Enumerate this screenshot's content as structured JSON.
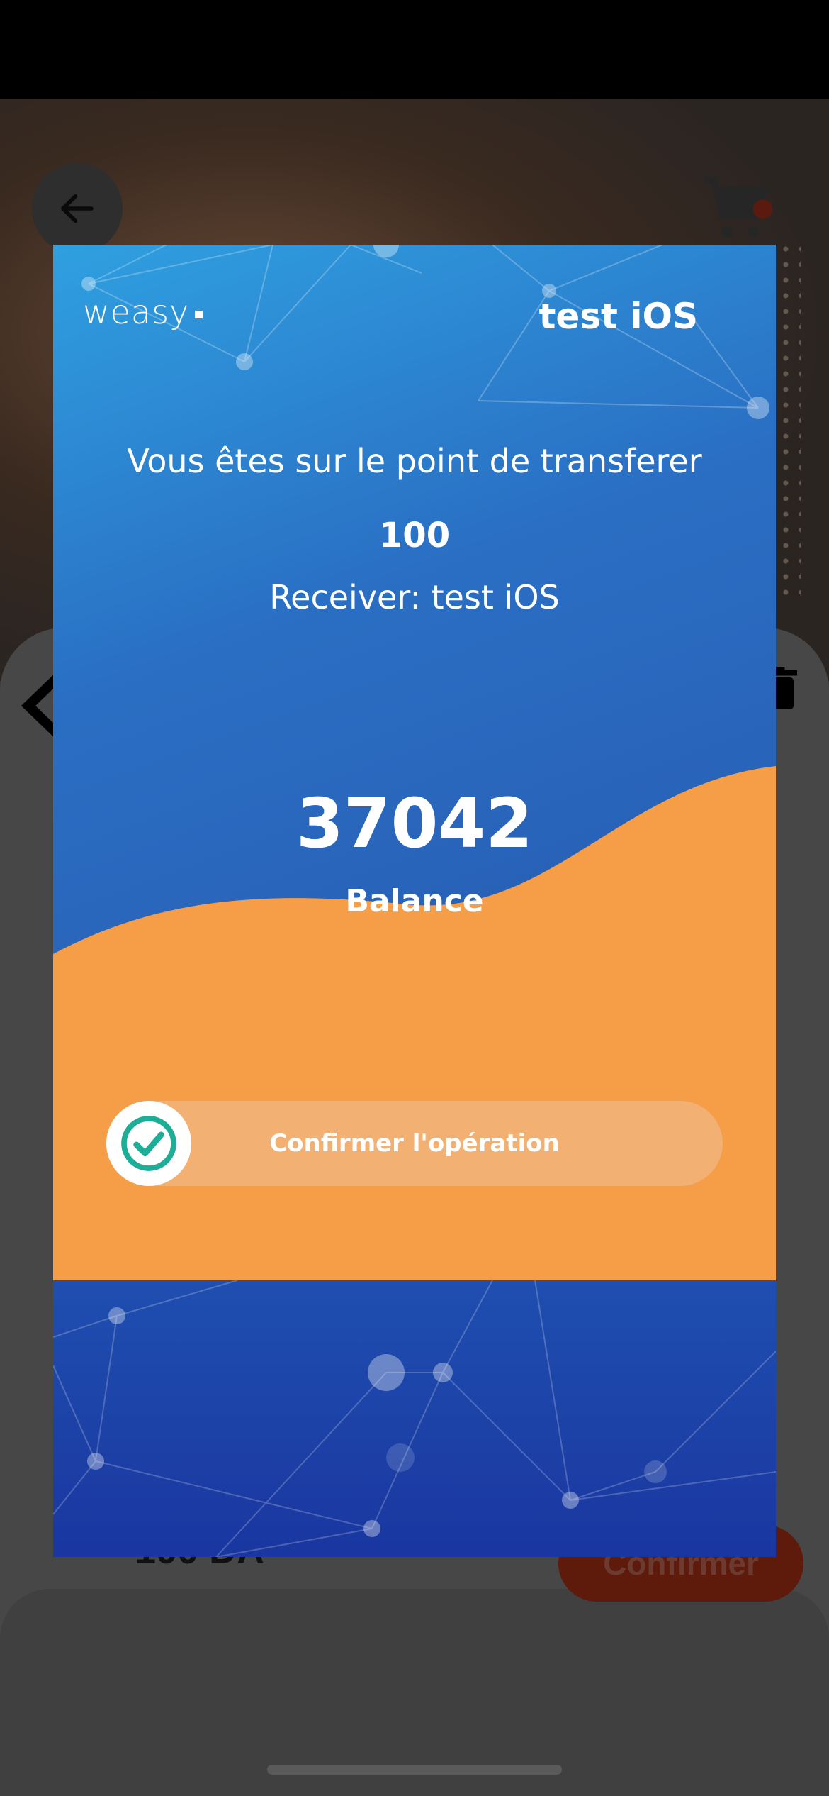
{
  "background": {
    "amount": "100 DA",
    "confirm_label": "Confirmer"
  },
  "modal": {
    "logo": "weasy",
    "account_name": "test iOS",
    "transfer_message": "Vous êtes sur le point de transferer",
    "transfer_amount": "100",
    "receiver": "Receiver: test iOS",
    "balance_value": "37042",
    "balance_label": "Balance",
    "slider_label": "Confirmer l'opération"
  },
  "colors": {
    "accent_orange": "#f69d48",
    "modal_blue": "#2a6fc4",
    "check_teal": "#1cae96"
  },
  "icons": {
    "back": "arrow-left-icon",
    "cart": "cart-download-icon",
    "trash": "trash-icon",
    "check": "check-circle-icon"
  }
}
